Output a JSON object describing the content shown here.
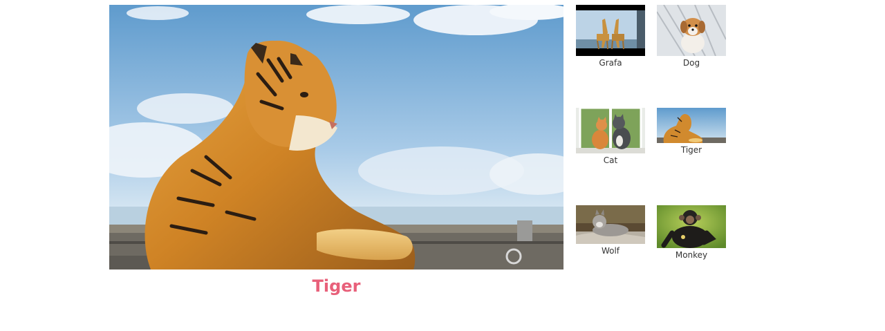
{
  "main": {
    "caption": "Tiger",
    "caption_color": "#e8607a",
    "image_subject": "tiger"
  },
  "gallery": {
    "items": [
      {
        "label": "Grafa",
        "subject": "giraffes"
      },
      {
        "label": "Dog",
        "subject": "puppy"
      },
      {
        "label": "Cat",
        "subject": "cats-at-window"
      },
      {
        "label": "Tiger",
        "subject": "tiger"
      },
      {
        "label": "Wolf",
        "subject": "wolf"
      },
      {
        "label": "Monkey",
        "subject": "chimpanzee"
      }
    ]
  }
}
